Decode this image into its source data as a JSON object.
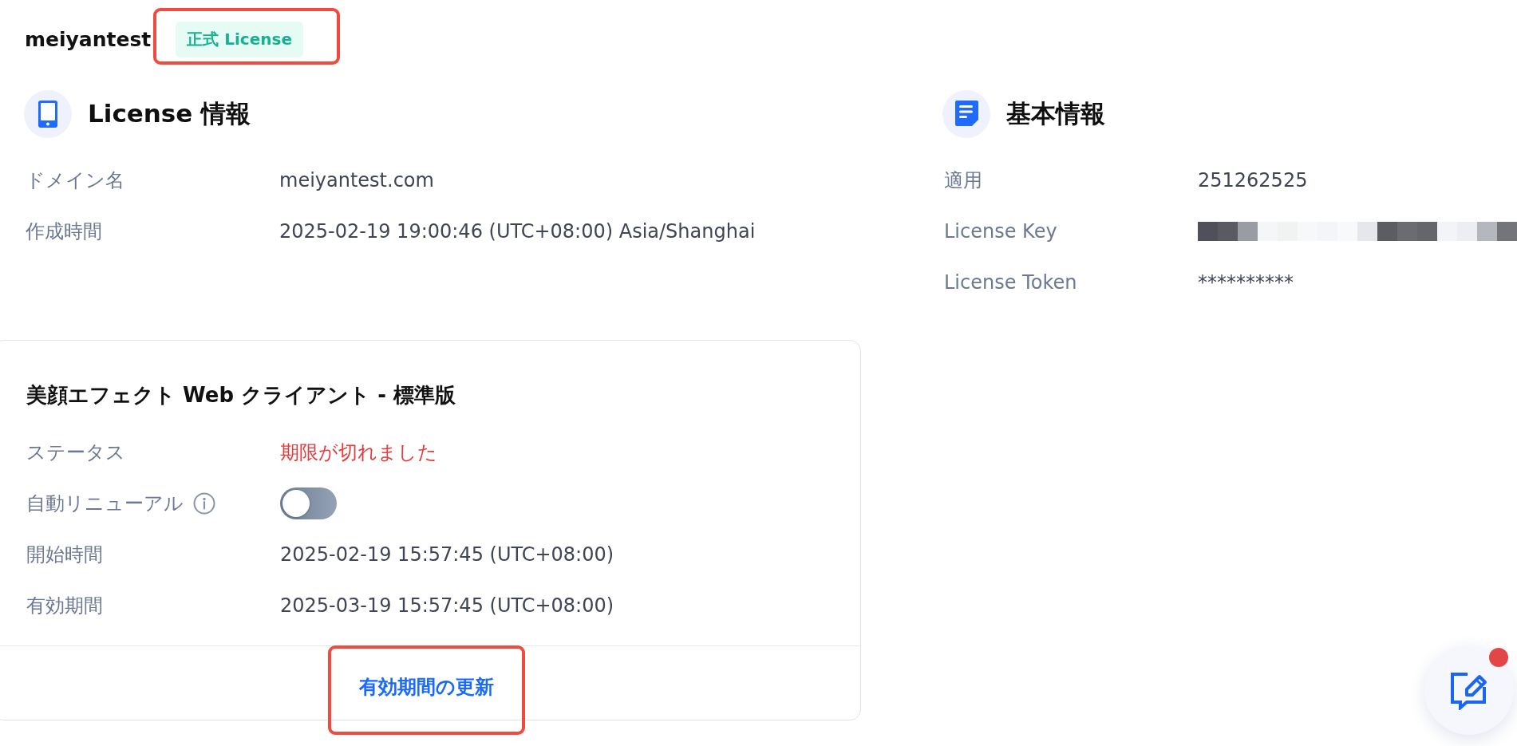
{
  "header": {
    "title": "meiyantest",
    "badge": {
      "label": "正式 License",
      "highlighted": true
    }
  },
  "license_info": {
    "title": "License 情報",
    "rows": [
      {
        "label": "ドメイン名",
        "value": "meiyantest.com"
      },
      {
        "label": "作成時間",
        "value": "2025-02-19 19:00:46 (UTC+08:00) Asia/Shanghai"
      }
    ]
  },
  "basic_info": {
    "title": "基本情報",
    "rows": [
      {
        "kind": "text",
        "label": "適用",
        "value": "251262525"
      },
      {
        "kind": "redacted",
        "label": "License Key"
      },
      {
        "kind": "text",
        "label": "License Token",
        "value": "**********"
      }
    ]
  },
  "product_card": {
    "title": "美顔エフェクト Web クライアント - 標準版",
    "rows": [
      {
        "kind": "status",
        "label": "ステータス",
        "value": "期限が切れました"
      },
      {
        "kind": "toggle",
        "label": "自動リニューアル",
        "info": true,
        "on": false
      },
      {
        "kind": "text",
        "label": "開始時間",
        "value": "2025-02-19 15:57:45 (UTC+08:00)"
      },
      {
        "kind": "text",
        "label": "有効期間",
        "value": "2025-03-19 15:57:45 (UTC+08:00)"
      }
    ],
    "action": {
      "label": "有効期間の更新",
      "highlighted": true
    }
  },
  "feedback_button": {
    "notification": true
  }
}
